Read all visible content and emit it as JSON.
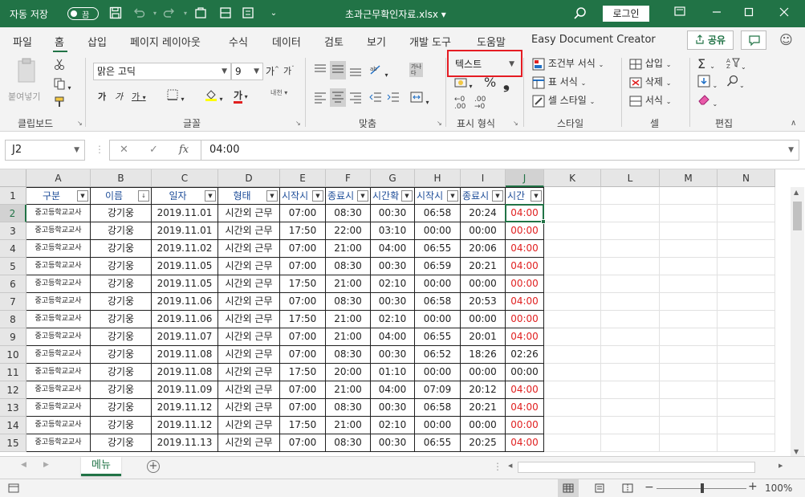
{
  "titlebar": {
    "autosave_label": "자동 저장",
    "autosave_state": "끔",
    "document_title": "초과근무확인자료.xlsx",
    "login_label": "로그인"
  },
  "tabs": [
    "파일",
    "홈",
    "삽입",
    "페이지 레이아웃",
    "수식",
    "데이터",
    "검토",
    "보기",
    "개발 도구",
    "도움말",
    "Easy Document Creator"
  ],
  "share_label": "공유",
  "ribbon": {
    "clipboard": {
      "paste_label": "붙여넣기",
      "group_label": "클립보드"
    },
    "font": {
      "font_name": "맑은 고딕",
      "font_size": "9",
      "group_label": "글꼴",
      "phonetic_label": "내천"
    },
    "alignment": {
      "group_label": "맞춤",
      "wrap_label": "가나\n다"
    },
    "number": {
      "format_value": "텍스트",
      "group_label": "표시 형식"
    },
    "styles": {
      "conditional_label": "조건부 서식",
      "table_label": "표 서식",
      "cell_style_label": "셀 스타일",
      "group_label": "스타일"
    },
    "cells": {
      "insert_label": "삽입",
      "delete_label": "삭제",
      "format_label": "서식",
      "group_label": "셀"
    },
    "editing": {
      "group_label": "편집"
    }
  },
  "formula_bar": {
    "name_box": "J2",
    "formula": "04:00"
  },
  "columns": [
    "A",
    "B",
    "C",
    "D",
    "E",
    "F",
    "G",
    "H",
    "I",
    "J",
    "K",
    "L",
    "M",
    "N"
  ],
  "rows": [
    "1",
    "2",
    "3",
    "4",
    "5",
    "6",
    "7",
    "8",
    "9",
    "10",
    "11",
    "12",
    "13",
    "14",
    "15"
  ],
  "headers": [
    "구분",
    "이름",
    "일자",
    "형태",
    "시작시",
    "종료시",
    "시간확",
    "시작시",
    "종료시",
    "시간"
  ],
  "data_rows": [
    [
      "중고등학교교사",
      "강기웅",
      "2019.11.01",
      "시간외 근무",
      "07:00",
      "08:30",
      "00:30",
      "06:58",
      "20:24",
      "04:00"
    ],
    [
      "중고등학교교사",
      "강기웅",
      "2019.11.01",
      "시간외 근무",
      "17:50",
      "22:00",
      "03:10",
      "00:00",
      "00:00",
      "00:00"
    ],
    [
      "중고등학교교사",
      "강기웅",
      "2019.11.02",
      "시간외 근무",
      "07:00",
      "21:00",
      "04:00",
      "06:55",
      "20:06",
      "04:00"
    ],
    [
      "중고등학교교사",
      "강기웅",
      "2019.11.05",
      "시간외 근무",
      "07:00",
      "08:30",
      "00:30",
      "06:59",
      "20:21",
      "04:00"
    ],
    [
      "중고등학교교사",
      "강기웅",
      "2019.11.05",
      "시간외 근무",
      "17:50",
      "21:00",
      "02:10",
      "00:00",
      "00:00",
      "00:00"
    ],
    [
      "중고등학교교사",
      "강기웅",
      "2019.11.06",
      "시간외 근무",
      "07:00",
      "08:30",
      "00:30",
      "06:58",
      "20:53",
      "04:00"
    ],
    [
      "중고등학교교사",
      "강기웅",
      "2019.11.06",
      "시간외 근무",
      "17:50",
      "21:00",
      "02:10",
      "00:00",
      "00:00",
      "00:00"
    ],
    [
      "중고등학교교사",
      "강기웅",
      "2019.11.07",
      "시간외 근무",
      "07:00",
      "21:00",
      "04:00",
      "06:55",
      "20:01",
      "04:00"
    ],
    [
      "중고등학교교사",
      "강기웅",
      "2019.11.08",
      "시간외 근무",
      "07:00",
      "08:30",
      "00:30",
      "06:52",
      "18:26",
      "02:26"
    ],
    [
      "중고등학교교사",
      "강기웅",
      "2019.11.08",
      "시간외 근무",
      "17:50",
      "20:00",
      "01:10",
      "00:00",
      "00:00",
      "00:00"
    ],
    [
      "중고등학교교사",
      "강기웅",
      "2019.11.09",
      "시간외 근무",
      "07:00",
      "21:00",
      "04:00",
      "07:09",
      "20:12",
      "04:00"
    ],
    [
      "중고등학교교사",
      "강기웅",
      "2019.11.12",
      "시간외 근무",
      "07:00",
      "08:30",
      "00:30",
      "06:58",
      "20:21",
      "04:00"
    ],
    [
      "중고등학교교사",
      "강기웅",
      "2019.11.12",
      "시간외 근무",
      "17:50",
      "21:00",
      "02:10",
      "00:00",
      "00:00",
      "00:00"
    ],
    [
      "중고등학교교사",
      "강기웅",
      "2019.11.13",
      "시간외 근무",
      "07:00",
      "08:30",
      "00:30",
      "06:55",
      "20:25",
      "04:00"
    ]
  ],
  "red_j_rows": [
    true,
    true,
    true,
    true,
    true,
    true,
    true,
    true,
    false,
    false,
    true,
    true,
    true,
    true
  ],
  "sheet_tab": "메뉴",
  "zoom": "100%",
  "colors": {
    "accent": "#217346",
    "highlight": "#e51c23",
    "red_text": "#e02020",
    "header_text": "#1f4e99"
  }
}
